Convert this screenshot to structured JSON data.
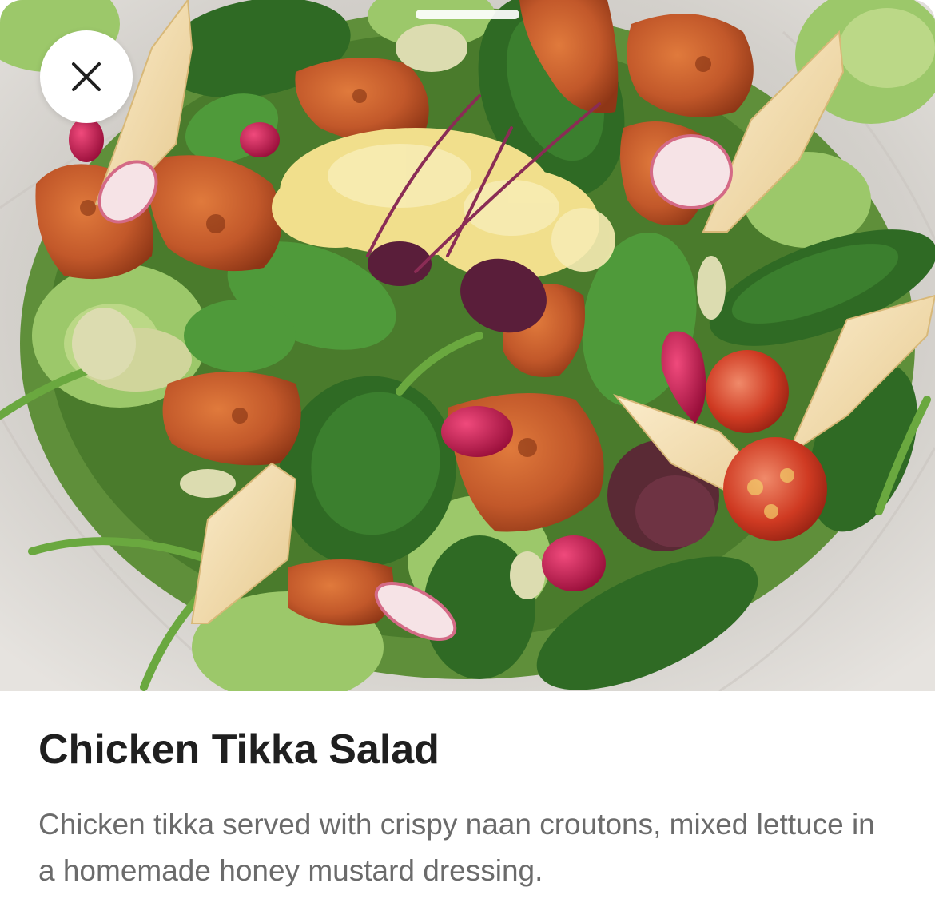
{
  "item": {
    "title": "Chicken Tikka Salad",
    "description": "Chicken tikka served with crispy naan croutons, mixed lettuce in a homemade honey mustard dressing."
  },
  "controls": {
    "close_icon": "close-x-icon",
    "grab_handle": "sheet-grab-handle"
  },
  "image": {
    "subject": "food-photo",
    "colors": {
      "plate": "#d9d6d2",
      "spinach": "#3f7a2e",
      "lettuce": "#8fbf5a",
      "chicken": "#c2582a",
      "naan": "#f2ddb0",
      "pickle": "#f1df8c",
      "radish": "#b8184a",
      "tomato": "#c0301f",
      "shiso": "#5a1e3a"
    }
  }
}
